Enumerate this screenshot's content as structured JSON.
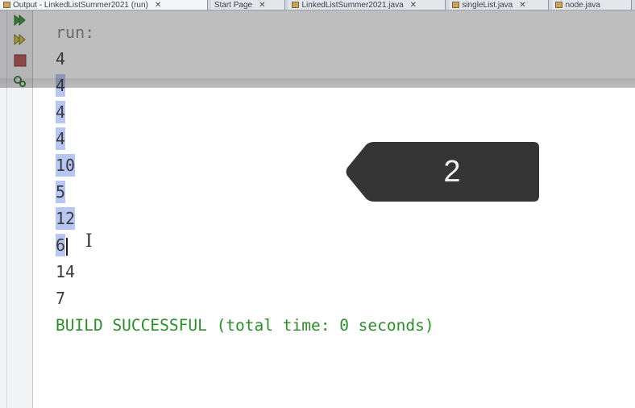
{
  "tabs": [
    {
      "label": "Output - LinkedListSummer2021 (run)",
      "close": "✕",
      "active": true
    },
    {
      "label": "Start Page",
      "close": "✕",
      "active": false
    },
    {
      "label": "LinkedListSummer2021.java",
      "close": "✕",
      "active": false
    },
    {
      "label": "singleList.java",
      "close": "✕",
      "active": false
    },
    {
      "label": "node.java",
      "close": "",
      "active": false
    }
  ],
  "toolbar": {
    "icons": [
      "rerun-icon",
      "rerun-with-options-icon",
      "stop-icon",
      "settings-icon"
    ]
  },
  "console": {
    "run_label": "run:",
    "lines": [
      "4",
      "4",
      "4",
      "4",
      "10",
      "5",
      "12",
      "6",
      "14",
      "7"
    ],
    "build_status": "BUILD SUCCESSFUL (total time: 0 seconds)"
  },
  "badge": {
    "number": "2"
  },
  "colors": {
    "selection": "#b8c6f4",
    "build_success": "#2e8b2e",
    "badge_bg": "#353535"
  }
}
